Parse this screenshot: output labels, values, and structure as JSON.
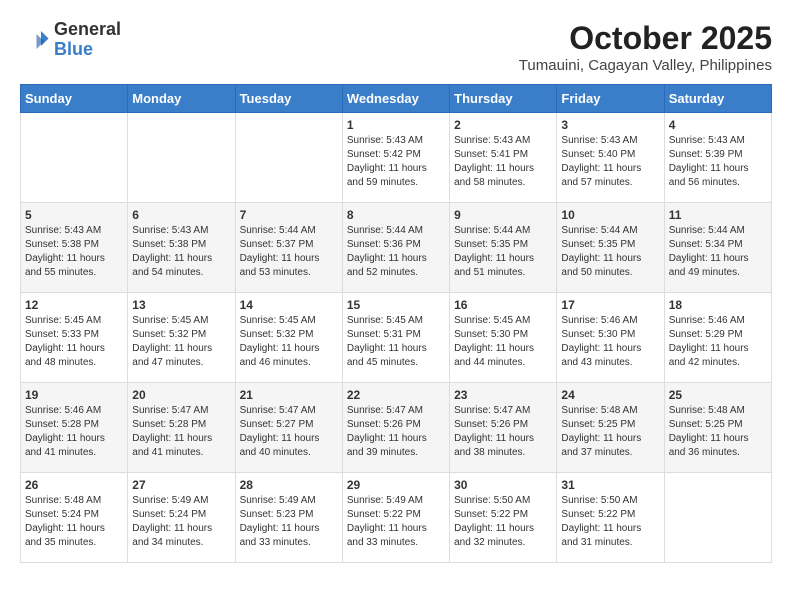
{
  "logo": {
    "general": "General",
    "blue": "Blue"
  },
  "title": "October 2025",
  "subtitle": "Tumauini, Cagayan Valley, Philippines",
  "days_of_week": [
    "Sunday",
    "Monday",
    "Tuesday",
    "Wednesday",
    "Thursday",
    "Friday",
    "Saturday"
  ],
  "weeks": [
    [
      {
        "day": "",
        "info": ""
      },
      {
        "day": "",
        "info": ""
      },
      {
        "day": "",
        "info": ""
      },
      {
        "day": "1",
        "info": "Sunrise: 5:43 AM\nSunset: 5:42 PM\nDaylight: 11 hours\nand 59 minutes."
      },
      {
        "day": "2",
        "info": "Sunrise: 5:43 AM\nSunset: 5:41 PM\nDaylight: 11 hours\nand 58 minutes."
      },
      {
        "day": "3",
        "info": "Sunrise: 5:43 AM\nSunset: 5:40 PM\nDaylight: 11 hours\nand 57 minutes."
      },
      {
        "day": "4",
        "info": "Sunrise: 5:43 AM\nSunset: 5:39 PM\nDaylight: 11 hours\nand 56 minutes."
      }
    ],
    [
      {
        "day": "5",
        "info": "Sunrise: 5:43 AM\nSunset: 5:38 PM\nDaylight: 11 hours\nand 55 minutes."
      },
      {
        "day": "6",
        "info": "Sunrise: 5:43 AM\nSunset: 5:38 PM\nDaylight: 11 hours\nand 54 minutes."
      },
      {
        "day": "7",
        "info": "Sunrise: 5:44 AM\nSunset: 5:37 PM\nDaylight: 11 hours\nand 53 minutes."
      },
      {
        "day": "8",
        "info": "Sunrise: 5:44 AM\nSunset: 5:36 PM\nDaylight: 11 hours\nand 52 minutes."
      },
      {
        "day": "9",
        "info": "Sunrise: 5:44 AM\nSunset: 5:35 PM\nDaylight: 11 hours\nand 51 minutes."
      },
      {
        "day": "10",
        "info": "Sunrise: 5:44 AM\nSunset: 5:35 PM\nDaylight: 11 hours\nand 50 minutes."
      },
      {
        "day": "11",
        "info": "Sunrise: 5:44 AM\nSunset: 5:34 PM\nDaylight: 11 hours\nand 49 minutes."
      }
    ],
    [
      {
        "day": "12",
        "info": "Sunrise: 5:45 AM\nSunset: 5:33 PM\nDaylight: 11 hours\nand 48 minutes."
      },
      {
        "day": "13",
        "info": "Sunrise: 5:45 AM\nSunset: 5:32 PM\nDaylight: 11 hours\nand 47 minutes."
      },
      {
        "day": "14",
        "info": "Sunrise: 5:45 AM\nSunset: 5:32 PM\nDaylight: 11 hours\nand 46 minutes."
      },
      {
        "day": "15",
        "info": "Sunrise: 5:45 AM\nSunset: 5:31 PM\nDaylight: 11 hours\nand 45 minutes."
      },
      {
        "day": "16",
        "info": "Sunrise: 5:45 AM\nSunset: 5:30 PM\nDaylight: 11 hours\nand 44 minutes."
      },
      {
        "day": "17",
        "info": "Sunrise: 5:46 AM\nSunset: 5:30 PM\nDaylight: 11 hours\nand 43 minutes."
      },
      {
        "day": "18",
        "info": "Sunrise: 5:46 AM\nSunset: 5:29 PM\nDaylight: 11 hours\nand 42 minutes."
      }
    ],
    [
      {
        "day": "19",
        "info": "Sunrise: 5:46 AM\nSunset: 5:28 PM\nDaylight: 11 hours\nand 41 minutes."
      },
      {
        "day": "20",
        "info": "Sunrise: 5:47 AM\nSunset: 5:28 PM\nDaylight: 11 hours\nand 41 minutes."
      },
      {
        "day": "21",
        "info": "Sunrise: 5:47 AM\nSunset: 5:27 PM\nDaylight: 11 hours\nand 40 minutes."
      },
      {
        "day": "22",
        "info": "Sunrise: 5:47 AM\nSunset: 5:26 PM\nDaylight: 11 hours\nand 39 minutes."
      },
      {
        "day": "23",
        "info": "Sunrise: 5:47 AM\nSunset: 5:26 PM\nDaylight: 11 hours\nand 38 minutes."
      },
      {
        "day": "24",
        "info": "Sunrise: 5:48 AM\nSunset: 5:25 PM\nDaylight: 11 hours\nand 37 minutes."
      },
      {
        "day": "25",
        "info": "Sunrise: 5:48 AM\nSunset: 5:25 PM\nDaylight: 11 hours\nand 36 minutes."
      }
    ],
    [
      {
        "day": "26",
        "info": "Sunrise: 5:48 AM\nSunset: 5:24 PM\nDaylight: 11 hours\nand 35 minutes."
      },
      {
        "day": "27",
        "info": "Sunrise: 5:49 AM\nSunset: 5:24 PM\nDaylight: 11 hours\nand 34 minutes."
      },
      {
        "day": "28",
        "info": "Sunrise: 5:49 AM\nSunset: 5:23 PM\nDaylight: 11 hours\nand 33 minutes."
      },
      {
        "day": "29",
        "info": "Sunrise: 5:49 AM\nSunset: 5:22 PM\nDaylight: 11 hours\nand 33 minutes."
      },
      {
        "day": "30",
        "info": "Sunrise: 5:50 AM\nSunset: 5:22 PM\nDaylight: 11 hours\nand 32 minutes."
      },
      {
        "day": "31",
        "info": "Sunrise: 5:50 AM\nSunset: 5:22 PM\nDaylight: 11 hours\nand 31 minutes."
      },
      {
        "day": "",
        "info": ""
      }
    ]
  ]
}
